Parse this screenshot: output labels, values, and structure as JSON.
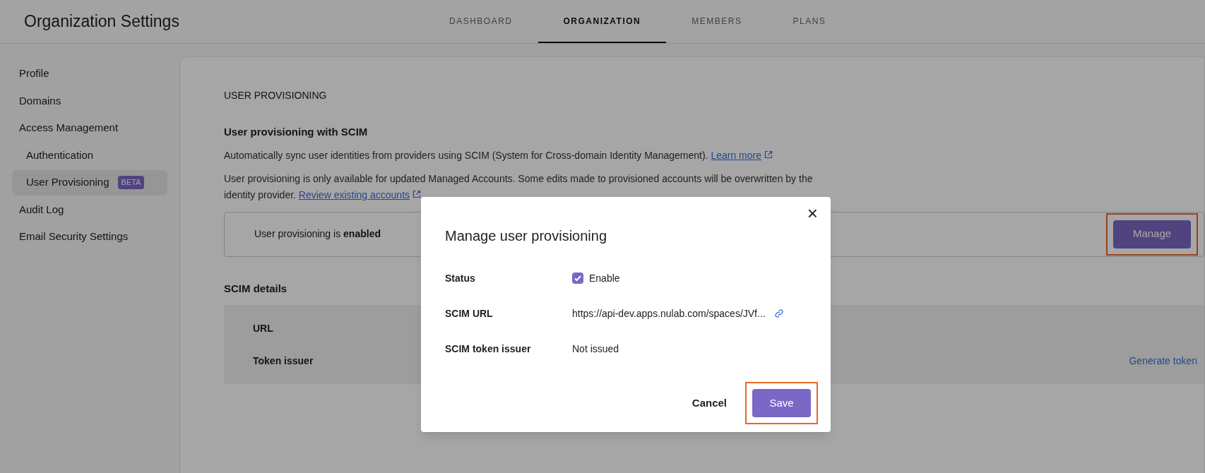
{
  "header": {
    "title": "Organization Settings"
  },
  "tabs": [
    {
      "label": "DASHBOARD",
      "selected": false
    },
    {
      "label": "ORGANIZATION",
      "selected": true
    },
    {
      "label": "MEMBERS",
      "selected": false
    },
    {
      "label": "PLANS",
      "selected": false
    }
  ],
  "sidebar": {
    "items": [
      {
        "label": "Profile",
        "selected": false
      },
      {
        "label": "Domains",
        "selected": false
      },
      {
        "label": "Access Management",
        "selected": false,
        "children": [
          {
            "label": "Authentication",
            "selected": false
          },
          {
            "label": "User Provisioning",
            "selected": true,
            "badge": "BETA"
          }
        ]
      },
      {
        "label": "Audit Log",
        "selected": false
      },
      {
        "label": "Email Security Settings",
        "selected": false
      }
    ]
  },
  "content": {
    "section_title": "USER PROVISIONING",
    "subsection_title": "User provisioning with SCIM",
    "paragraphs": [
      {
        "text": "Automatically sync user identities from providers using SCIM (System for Cross-domain Identity Management).",
        "link": "Learn more"
      },
      {
        "text": "User provisioning is only available for updated Managed Accounts. Some edits made to provisioned accounts will be overwritten by the identity provider.",
        "link": "Review existing accounts"
      }
    ],
    "status": {
      "text": "User provisioning is **enabled**",
      "button": "Manage",
      "highlighted": true
    },
    "details": {
      "title": "SCIM details",
      "rows": [
        {
          "label": "URL"
        },
        {
          "label": "Token issuer",
          "action": "Generate token"
        }
      ]
    }
  },
  "modal": {
    "title": "Manage user provisioning",
    "close": "×",
    "fields": [
      {
        "kind": "checkbox",
        "label": "Status",
        "checked": true,
        "text": "Enable"
      },
      {
        "kind": "link",
        "label": "SCIM URL",
        "value": "https://api-dev.apps.nulab.com/spaces/JVf..."
      },
      {
        "kind": "text",
        "label": "SCIM token issuer",
        "value": "Not issued"
      }
    ],
    "cancel": "Cancel",
    "save": {
      "label": "Save",
      "highlighted": true
    }
  }
}
